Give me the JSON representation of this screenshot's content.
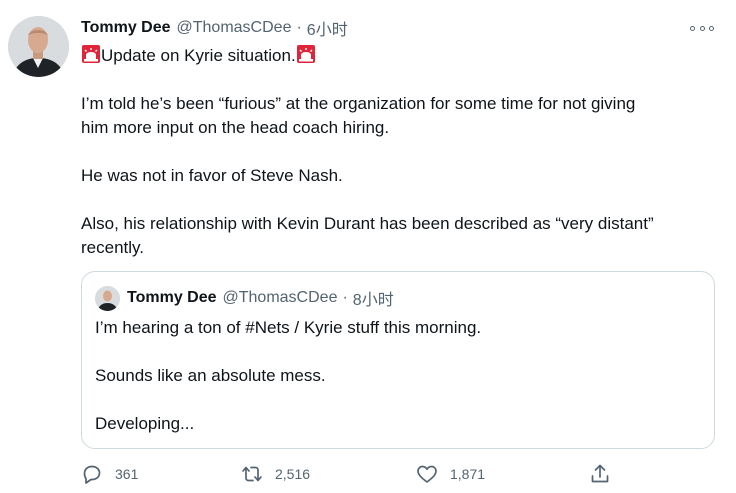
{
  "tweet": {
    "author_name": "Tommy Dee",
    "handle": "@ThomasCDee",
    "separator": "·",
    "time": "6小时",
    "lines": {
      "l1": "Update on Kyrie situation.",
      "l2": "I’m told he’s been “furious” at the organization for some time for not giving",
      "l3": "him more input on the head coach hiring.",
      "l4": "He was not in favor of Steve Nash.",
      "l5": "Also, his relationship with Kevin Durant has been described as “very distant”",
      "l6": "recently."
    },
    "siren_emoji": "🚨"
  },
  "quoted_tweet": {
    "author_name": "Tommy Dee",
    "handle": "@ThomasCDee",
    "separator": "·",
    "time": "8小时",
    "lines": {
      "l1": "I’m hearing a ton of #Nets / Kyrie stuff this morning.",
      "l2": "Sounds like an absolute mess.",
      "l3": "Developing..."
    }
  },
  "actions": {
    "replies": "361",
    "retweets": "2,516",
    "likes": "1,871"
  },
  "icons": {
    "more": "more-horizontal-icon",
    "reply": "reply-icon",
    "retweet": "retweet-icon",
    "like": "heart-icon",
    "share": "share-icon"
  },
  "colors": {
    "text": "#0f1419",
    "secondary": "#536471",
    "border": "#cfd9de",
    "siren_red": "#e0243a"
  }
}
